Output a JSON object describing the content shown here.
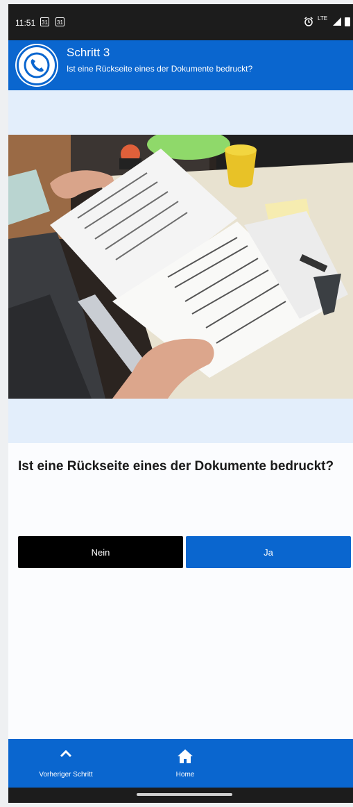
{
  "status_bar": {
    "time": "11:51",
    "calendar_day_1": "31",
    "calendar_day_2": "31",
    "network": "LTE"
  },
  "header": {
    "step_title": "Schritt 3",
    "step_subtitle": "Ist eine Rückseite eines der Dokumente bedruckt?",
    "avatar_icon": "phone-icon"
  },
  "photo": {
    "icon": "document-photo"
  },
  "question": {
    "text": "Ist eine Rückseite eines der Dokumente bedruckt?"
  },
  "answers": {
    "no_label": "Nein",
    "yes_label": "Ja"
  },
  "bottom_nav": {
    "prev_label": "Vorheriger Schritt",
    "home_label": "Home"
  },
  "colors": {
    "primary": "#0a66cf",
    "band": "#e3eefb",
    "no_button": "#000000"
  }
}
